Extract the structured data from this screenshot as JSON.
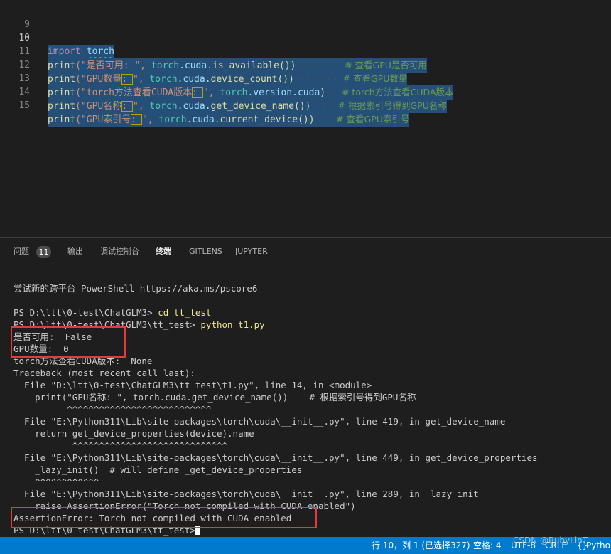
{
  "editor": {
    "lines": [
      {
        "n": "9"
      },
      {
        "n": "10"
      },
      {
        "n": "11"
      },
      {
        "n": "12"
      },
      {
        "n": "13"
      },
      {
        "n": "14"
      },
      {
        "n": "15"
      }
    ],
    "code": {
      "l10": {
        "kw": "import",
        "mod": "torch"
      },
      "l11": {
        "fn": "print",
        "s1": "(\"是否可用: \", ",
        "a": "torch",
        "b": ".cuda.",
        "c": "is_available",
        "d": "())",
        "cm": "# 查看GPU是否可用"
      },
      "l12": {
        "fn": "print",
        "s1": "(\"GPU数量",
        "s2": ": ",
        "s3": "\", ",
        "a": "torch",
        "b": ".cuda.",
        "c": "device_count",
        "d": "())",
        "cm": "# 查看GPU数量"
      },
      "l13": {
        "fn": "print",
        "s1": "(\"torch方法查看CUDA版本",
        "s2": ": ",
        "s3": "\", ",
        "a": "torch",
        "b": ".version.",
        "c": "cuda",
        "d": ")",
        "cm": "# torch方法查看CUDA版本"
      },
      "l14": {
        "fn": "print",
        "s1": "(\"GPU名称",
        "s2": ": ",
        "s3": "\", ",
        "a": "torch",
        "b": ".cuda.",
        "c": "get_device_name",
        "d": "())",
        "cm": "# 根据索引号得到GPU名称"
      },
      "l15": {
        "fn": "print",
        "s1": "(\"GPU索引号",
        "s2": ": ",
        "s3": "\", ",
        "a": "torch",
        "b": ".cuda.",
        "c": "current_device",
        "d": "())",
        "cm": "# 查看GPU索引号"
      }
    }
  },
  "panel": {
    "tabs": [
      {
        "label": "问题",
        "badge": "11"
      },
      {
        "label": "输出"
      },
      {
        "label": "调试控制台"
      },
      {
        "label": "终端"
      },
      {
        "label": "GITLENS"
      },
      {
        "label": "JUPYTER"
      }
    ],
    "terminal": [
      "尝试新的跨平台 PowerShell https://aka.ms/pscore6",
      "",
      "PS D:\\ltt\\0-test\\ChatGLM3>",
      "PS D:\\ltt\\0-test\\ChatGLM3\\tt_test>",
      "是否可用:  False",
      "GPU数量:  0",
      "torch方法查看CUDA版本:  None",
      "Traceback (most recent call last):",
      "  File \"D:\\ltt\\0-test\\ChatGLM3\\tt_test\\t1.py\", line 14, in <module>",
      "    print(\"GPU名称: \", torch.cuda.get_device_name())    # 根据索引号得到GPU名称",
      "          ^^^^^^^^^^^^^^^^^^^^^^^^^^^",
      "  File \"E:\\Python311\\Lib\\site-packages\\torch\\cuda\\__init__.py\", line 419, in get_device_name",
      "    return get_device_properties(device).name",
      "           ^^^^^^^^^^^^^^^^^^^^^^^^^^^^^",
      "  File \"E:\\Python311\\Lib\\site-packages\\torch\\cuda\\__init__.py\", line 449, in get_device_properties",
      "    _lazy_init()  # will define _get_device_properties",
      "    ^^^^^^^^^^^^",
      "  File \"E:\\Python311\\Lib\\site-packages\\torch\\cuda\\__init__.py\", line 289, in _lazy_init",
      "    raise AssertionError(\"Torch not compiled with CUDA enabled\")",
      "AssertionError: Torch not compiled with CUDA enabled",
      "PS D:\\ltt\\0-test\\ChatGLM3\\tt_test>"
    ],
    "commands": {
      "cd": " cd tt_test",
      "run": " python t1.py"
    }
  },
  "statusbar": {
    "position": "行 10，列 1 (已选择327)",
    "spaces": "空格: 4",
    "encoding": "UTF-8",
    "eol": "CRLF",
    "lang_icon": "braces-icon",
    "language": "Python",
    "watermark": "CSDN @RubyLinT"
  },
  "colors": {
    "accent": "#007acc",
    "highlight_box": "#e03c3c"
  }
}
